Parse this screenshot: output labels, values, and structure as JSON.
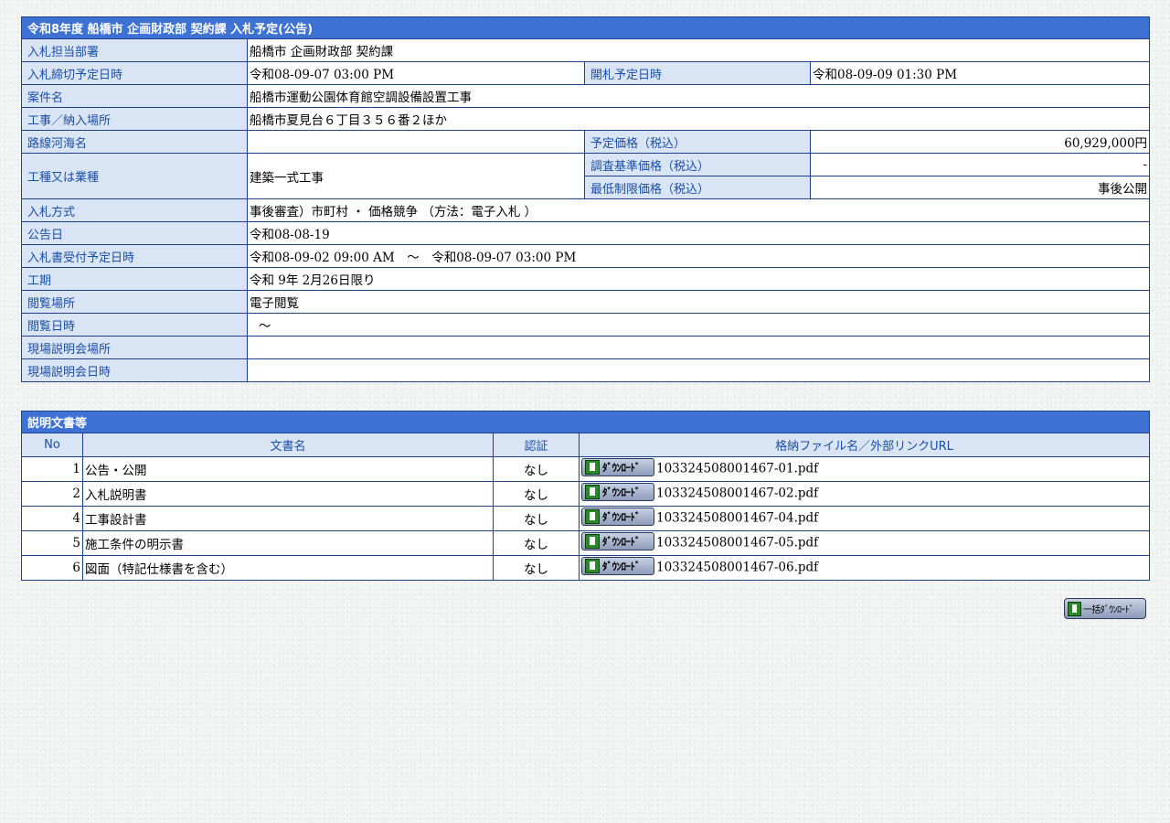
{
  "notice": {
    "title": "令和8年度 船橋市 企画財政部 契約課 入札予定(公告)",
    "rows": {
      "dept_label": "入札担当部署",
      "dept_value": "船橋市 企画財政部 契約課",
      "deadline_label": "入札締切予定日時",
      "deadline_value": "令和08-09-07 03:00 PM",
      "opening_label": "開札予定日時",
      "opening_value": "令和08-09-09 01:30 PM",
      "case_label": "案件名",
      "case_value": "船橋市運動公園体育館空調設備設置工事",
      "place_label": "工事／納入場所",
      "place_value": "船橋市夏見台６丁目３５６番２ほか",
      "route_label": "路線河海名",
      "route_value": "",
      "planned_price_label": "予定価格（税込）",
      "planned_price_value": "60,929,000円",
      "type_label": "工種又は業種",
      "type_value": "建築一式工事",
      "survey_price_label": "調査基準価格（税込）",
      "survey_price_value": "-",
      "min_price_label": "最低制限価格（税込）",
      "min_price_value": "事後公開",
      "method_label": "入札方式",
      "method_value": "事後審査）市町村 ・ 価格競争 （方法：電子入札 ）",
      "announce_label": "公告日",
      "announce_value": "令和08-08-19",
      "receipt_label": "入札書受付予定日時",
      "receipt_value": "令和08-09-02 09:00 AM　～　令和08-09-07 03:00 PM",
      "period_label": "工期",
      "period_value": "令和 9年 2月26日限り",
      "view_place_label": "閲覧場所",
      "view_place_value": "電子閲覧",
      "view_date_label": "閲覧日時",
      "view_date_value": "～",
      "site_place_label": "現場説明会場所",
      "site_place_value": "",
      "site_date_label": "現場説明会日時",
      "site_date_value": ""
    }
  },
  "documents": {
    "title": "説明文書等",
    "headers": {
      "no": "No",
      "name": "文書名",
      "auth": "認証",
      "file": "格納ファイル名／外部リンクURL"
    },
    "download_label": "ﾀﾞｳﾝﾛｰﾄﾞ",
    "rows": [
      {
        "no": "1",
        "name": "公告・公開",
        "auth": "なし",
        "file": "103324508001467-01.pdf"
      },
      {
        "no": "2",
        "name": "入札説明書",
        "auth": "なし",
        "file": "103324508001467-02.pdf"
      },
      {
        "no": "4",
        "name": "工事設計書",
        "auth": "なし",
        "file": "103324508001467-04.pdf"
      },
      {
        "no": "5",
        "name": "施工条件の明示書",
        "auth": "なし",
        "file": "103324508001467-05.pdf"
      },
      {
        "no": "6",
        "name": "図面（特記仕様書を含む）",
        "auth": "なし",
        "file": "103324508001467-06.pdf"
      }
    ],
    "bulk_download_label": "一括ﾀﾞｳﾝﾛｰﾄﾞ"
  }
}
